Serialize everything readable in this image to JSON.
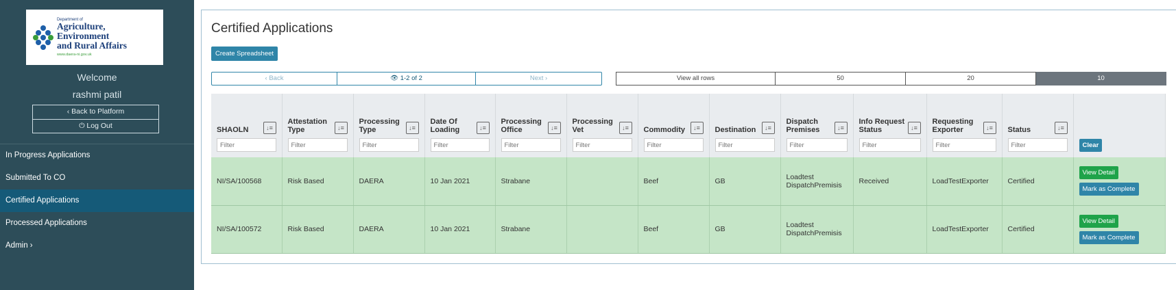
{
  "sidebar": {
    "logo": {
      "line1": "Department of",
      "line2": "Agriculture, Environment",
      "line3": "and Rural Affairs",
      "url": "www.daera-ni.gov.uk"
    },
    "welcome": "Welcome",
    "username": "rashmi patil",
    "back_label": "‹ Back to Platform",
    "logout_label": "⏻ Log Out",
    "items": [
      {
        "label": "In Progress Applications"
      },
      {
        "label": "Submitted To CO"
      },
      {
        "label": "Certified Applications"
      },
      {
        "label": "Processed Applications"
      },
      {
        "label": "Admin ›"
      }
    ]
  },
  "main": {
    "title": "Certified Applications",
    "create_button": "Create Spreadsheet",
    "pager": {
      "back": "‹ Back",
      "current": "👁 1-2 of 2",
      "next": "Next ›"
    },
    "rows_options": [
      "View all rows",
      "50",
      "20",
      "10"
    ],
    "active_rows": "10",
    "filter_placeholder": "Filter",
    "clear_label": "Clear",
    "columns": [
      "SHAOLN",
      "Attestation Type",
      "Processing Type",
      "Date Of Loading",
      "Processing Office",
      "Processing Vet",
      "Commodity",
      "Destination",
      "Dispatch Premises",
      "Info Request Status",
      "Requesting Exporter",
      "Status"
    ],
    "rows": [
      {
        "cells": [
          "NI/SA/100568",
          "Risk Based",
          "DAERA",
          "10 Jan 2021",
          "Strabane",
          "",
          "Beef",
          "GB",
          "Loadtest DispatchPremisis",
          "Received",
          "LoadTestExporter",
          "Certified"
        ]
      },
      {
        "cells": [
          "NI/SA/100572",
          "Risk Based",
          "DAERA",
          "10 Jan 2021",
          "Strabane",
          "",
          "Beef",
          "GB",
          "Loadtest DispatchPremisis",
          "",
          "LoadTestExporter",
          "Certified"
        ]
      }
    ],
    "view_detail": "View Detail",
    "mark_complete": "Mark as Complete"
  },
  "colors": {
    "sidebar_bg": "#2d4d59",
    "active_nav": "#155a78",
    "accent": "#2f85a8",
    "row_bg": "#c5e5c7",
    "success": "#1fa34a"
  }
}
